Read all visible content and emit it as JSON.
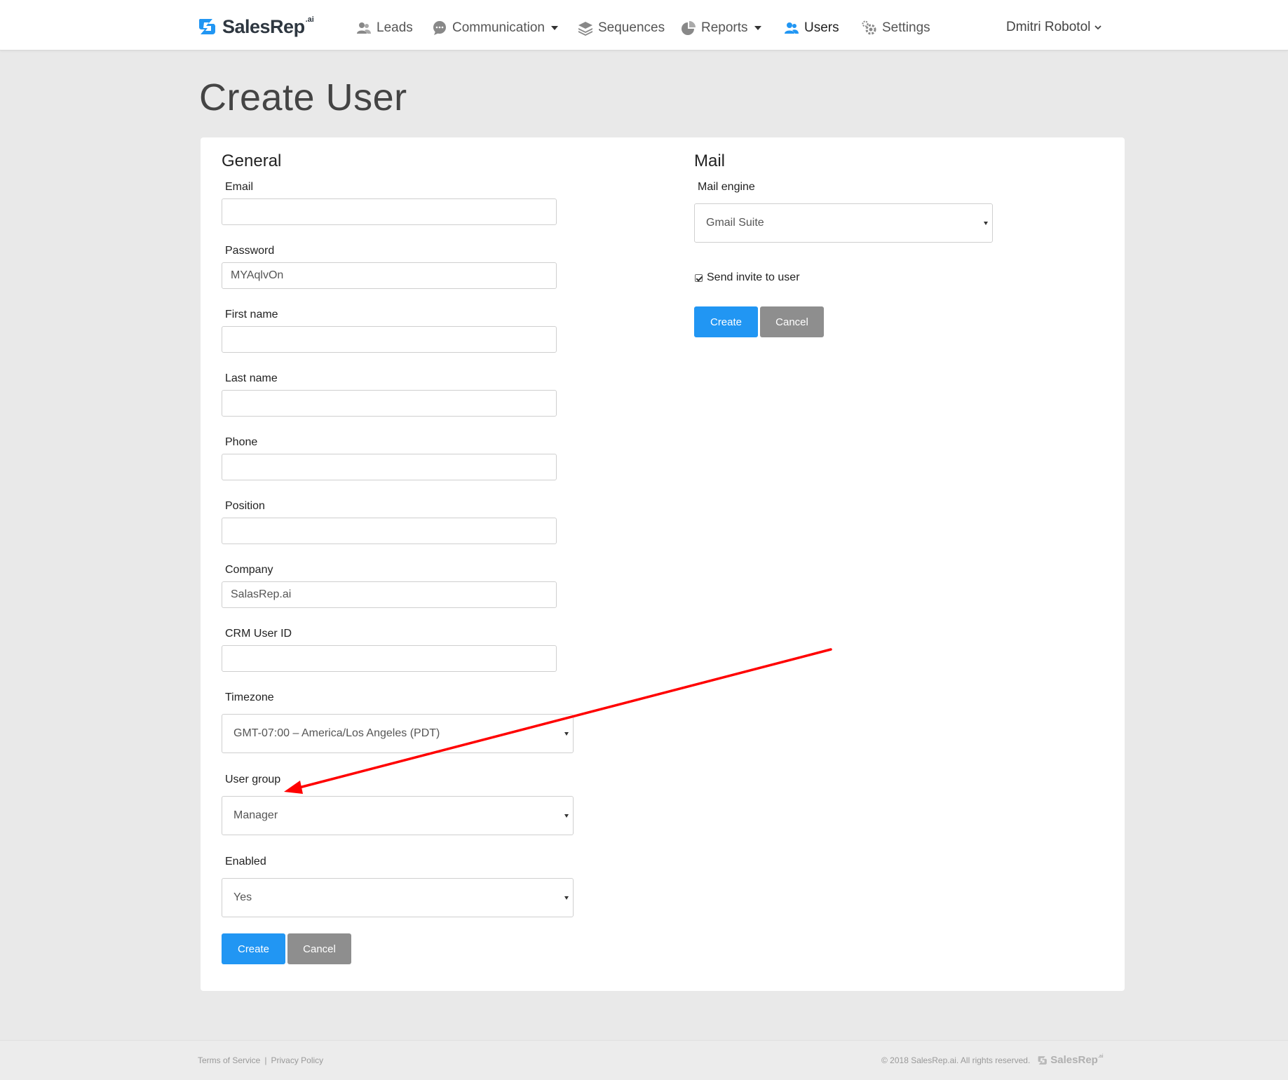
{
  "brand": {
    "name": "SalesRep",
    "suffix": ".ai"
  },
  "nav": {
    "items": [
      {
        "label": "Leads",
        "icon": "users-icon"
      },
      {
        "label": "Communication",
        "icon": "chat-icon",
        "dropdown": true
      },
      {
        "label": "Sequences",
        "icon": "layers-icon"
      },
      {
        "label": "Reports",
        "icon": "pie-chart-icon",
        "dropdown": true
      },
      {
        "label": "Users",
        "icon": "user-group-icon",
        "active": true
      },
      {
        "label": "Settings",
        "icon": "gears-icon"
      }
    ],
    "user_name": "Dmitri Robotol"
  },
  "page": {
    "title": "Create User"
  },
  "general": {
    "title": "General",
    "email": {
      "label": "Email",
      "value": ""
    },
    "password": {
      "label": "Password",
      "value": "MYAqlvOn"
    },
    "first_name": {
      "label": "First name",
      "value": ""
    },
    "last_name": {
      "label": "Last name",
      "value": ""
    },
    "phone": {
      "label": "Phone",
      "value": ""
    },
    "position": {
      "label": "Position",
      "value": ""
    },
    "company": {
      "label": "Company",
      "value": "SalasRep.ai"
    },
    "crm_user_id": {
      "label": "CRM User ID",
      "value": ""
    },
    "timezone": {
      "label": "Timezone",
      "value": "GMT-07:00 – America/Los Angeles (PDT)"
    },
    "user_group": {
      "label": "User group",
      "value": "Manager"
    },
    "enabled": {
      "label": "Enabled",
      "value": "Yes"
    },
    "create_label": "Create",
    "cancel_label": "Cancel"
  },
  "mail": {
    "title": "Mail",
    "engine": {
      "label": "Mail engine",
      "value": "Gmail Suite"
    },
    "send_invite": {
      "label": "Send invite to user",
      "checked": true
    },
    "create_label": "Create",
    "cancel_label": "Cancel"
  },
  "footer": {
    "terms": "Terms of Service",
    "separator": "|",
    "privacy": "Privacy Policy",
    "copyright": "© 2018 SalesRep.ai. All rights reserved.",
    "logo_name": "SalesRep",
    "logo_suffix": ".ai"
  },
  "colors": {
    "primary": "#2196f3",
    "secondary_button": "#8e8e8e",
    "background": "#e9e9e9",
    "annotation_arrow": "#ff0000"
  }
}
